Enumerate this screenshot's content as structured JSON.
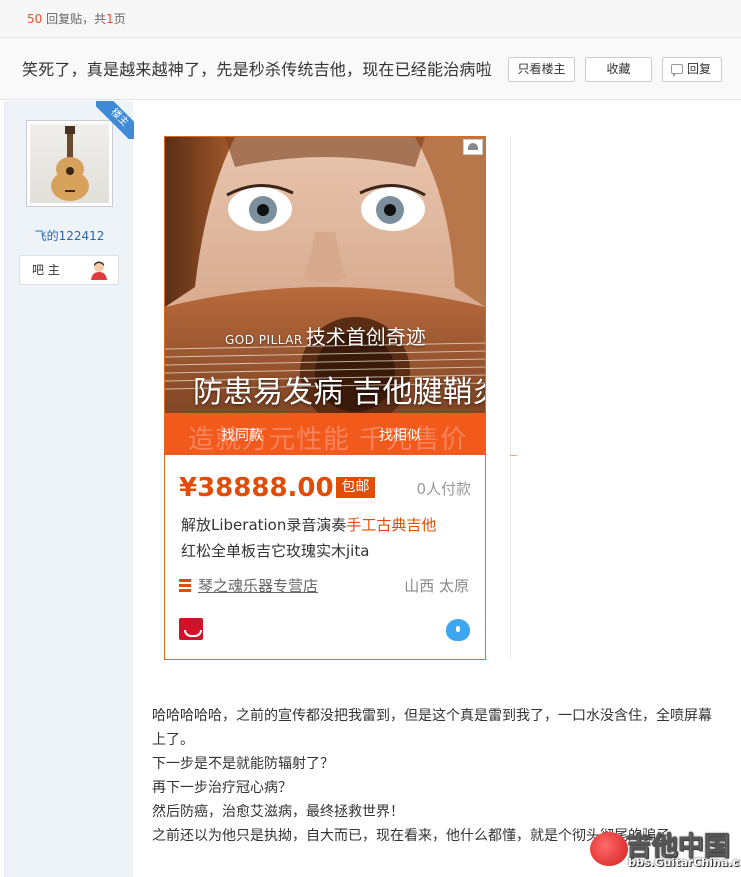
{
  "pager": {
    "reply_count": "50",
    "reply_label": " 回复贴，共",
    "page_count": "1",
    "page_label": "页"
  },
  "thread": {
    "title": "笑死了，真是越来越神了，先是秒杀传统吉他，现在已经能治病啦",
    "only_op_label": "只看楼主",
    "favorite_label": "收藏",
    "reply_label": "回复"
  },
  "author": {
    "badge": "楼主",
    "username": "飞的122412",
    "role": "吧 主"
  },
  "product": {
    "image_caption_small": "GOD PILLAR",
    "image_caption_line1": "技术首创奇迹",
    "image_caption_line2": "防患易发病  吉他腱鞘炎",
    "banner_ghost_text": "造就万元性能  千元售价",
    "same_style_label": "找同款",
    "similar_label": "找相似",
    "price": "¥38888.00",
    "free_shipping": "包邮",
    "sold": "0人付款",
    "title_prefix": "解放Liberation录音演奏",
    "title_highlight": "手工古典吉他",
    "title_line2": "红松全单板吉它玫瑰实木jita",
    "shop_name": "琴之魂乐器专营店",
    "location": "山西 太原"
  },
  "post": {
    "lines": [
      "哈哈哈哈哈，之前的宣传都没把我雷到，但是这个真是雷到我了，一口水没含住，全喷屏幕",
      "上了。",
      "下一步是不是就能防辐射了？",
      "再下一步治疗冠心病？",
      "然后防癌，治愈艾滋病，最终拯救世界！",
      "之前还以为他只是执拗，自大而已，现在看来，他什么都懂，就是个彻头彻尾的骗子"
    ]
  },
  "watermark": {
    "name": "吉他中国",
    "url": "bbs.GuitarChina.com"
  },
  "colors": {
    "accent_orange": "#e14c07",
    "link_blue": "#2d64b3",
    "badge_blue": "#3e8ad6"
  }
}
